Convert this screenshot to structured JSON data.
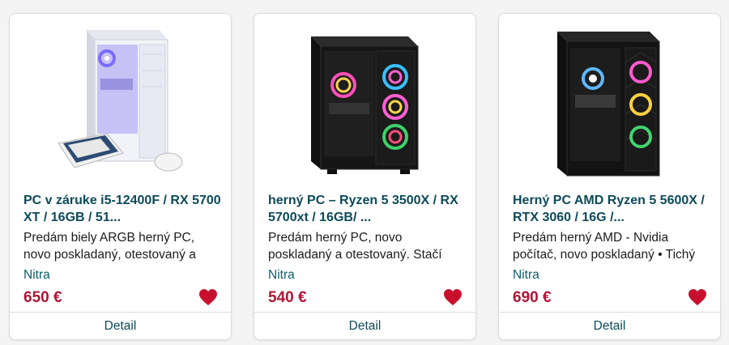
{
  "listings": [
    {
      "title": "PC v záruke i5-12400F / RX 5700 XT / 16GB / 51...",
      "description": "Predám biely ARGB herný PC, novo poskladaný, otestovaný a",
      "location": "Nitra",
      "price": "650 €",
      "detail_label": "Detail",
      "image": "white-pc-case-with-keyboard-and-mouse"
    },
    {
      "title": "herný PC – Ryzen 5 3500X / RX 5700xt / 16GB/ ...",
      "description": "Predám herný PC, novo poskladaný a otestovaný. Stačí",
      "location": "Nitra",
      "price": "540 €",
      "detail_label": "Detail",
      "image": "black-pc-case-rgb-fans"
    },
    {
      "title": "Herný PC AMD Ryzen 5 5600X / RTX 3060 / 16G /...",
      "description": "Predám herný AMD - Nvidia počítač, novo poskladaný • Tichý",
      "location": "Nitra",
      "price": "690 €",
      "detail_label": "Detail",
      "image": "black-pc-case-mesh-rgb-fans"
    }
  ],
  "colors": {
    "title": "#0d4a5a",
    "price": "#b11535",
    "heart": "#c8102e"
  },
  "icons": {
    "favorite": "heart-icon"
  }
}
